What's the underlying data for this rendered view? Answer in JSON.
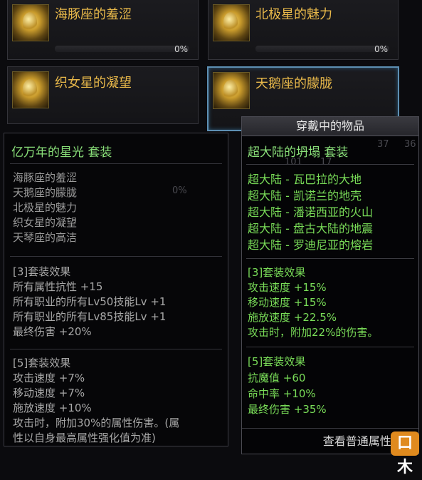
{
  "slots": [
    {
      "name": "海豚座的羞涩",
      "percent": "0%"
    },
    {
      "name": "北极星的魅力",
      "percent": "0%"
    },
    {
      "name": "织女星的凝望"
    },
    {
      "name": "天鹅座的朦胧"
    }
  ],
  "background_fragments": {
    "percent": "0%",
    "num_a": "37",
    "num_b": "36",
    "num_c": "101",
    "num_d": "17"
  },
  "left_tooltip": {
    "title": "亿万年的星光  套装",
    "members": [
      "海豚座的羞涩",
      "天鹅座的朦胧",
      "北极星的魅力",
      "织女星的凝望",
      "天琴座的高洁"
    ],
    "effect3": {
      "header": "[3]套装效果",
      "lines": [
        "所有属性抗性 +15",
        "所有职业的所有Lv50技能Lv +1",
        "所有职业的所有Lv85技能Lv +1",
        "最终伤害 +20%"
      ]
    },
    "effect5": {
      "header": "[5]套装效果",
      "lines": [
        "攻击速度 +7%",
        "移动速度 +7%",
        "施放速度 +10%",
        "攻击时，附加30%的属性伤害。(属",
        "性以自身最高属性强化值为准)"
      ]
    }
  },
  "right_tooltip": {
    "header": "穿戴中的物品",
    "title": "超大陆的坍塌  套装",
    "members": [
      "超大陆 - 瓦巴拉的大地",
      "超大陆 - 凯诺兰的地壳",
      "超大陆 - 潘诺西亚的火山",
      "超大陆 - 盘古大陆的地震",
      "超大陆 - 罗迪尼亚的熔岩"
    ],
    "effect3": {
      "header": "[3]套装效果",
      "lines": [
        "攻击速度 +15%",
        "移动速度 +15%",
        "施放速度 +22.5%",
        "攻击时，附加22%的伤害。"
      ]
    },
    "effect5": {
      "header": "[5]套装效果",
      "lines": [
        "抗魔值 +60",
        "命中率 +10%",
        "最终伤害 +35%"
      ]
    },
    "footer": "查看普通属性("
  },
  "watermark": "口木",
  "colors": {
    "set_title": "#8ae07a",
    "set_parts": "#79dc58",
    "slot_name": "#e9b94a",
    "selected_border": "#5d8fb3"
  }
}
